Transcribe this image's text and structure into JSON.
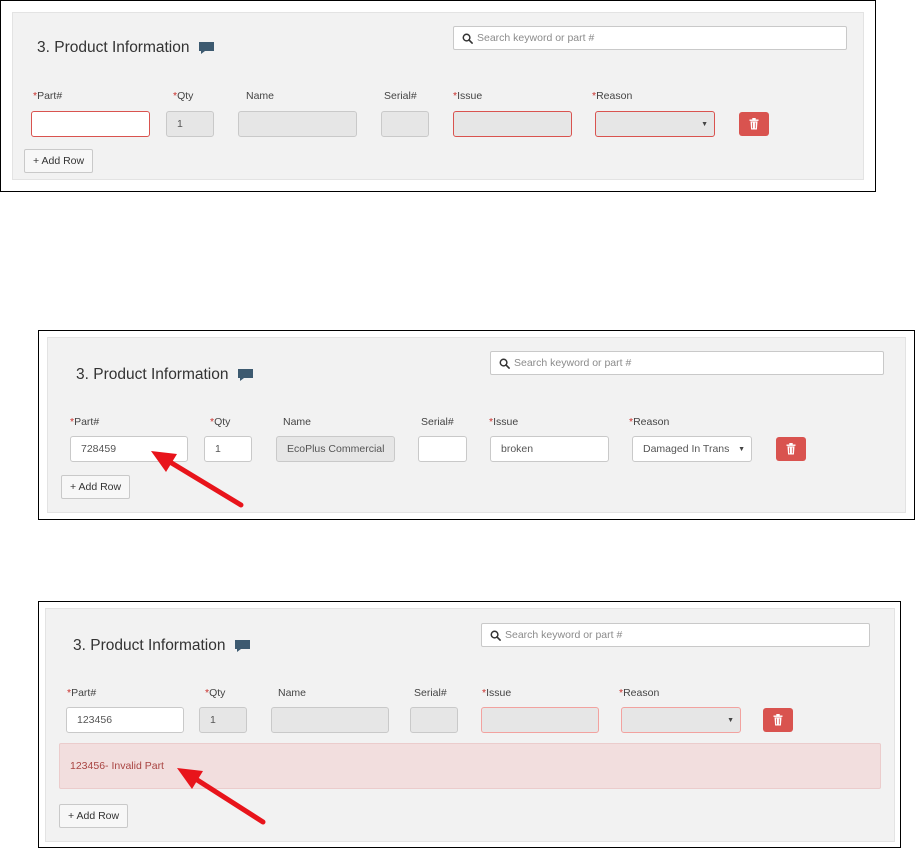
{
  "colors": {
    "required_asterisk": "#c9302c",
    "delete_button": "#d9534f",
    "error_border": "#d9534f",
    "alert_background": "#f2dede",
    "alert_text": "#a94442",
    "annotation_arrow": "#e8141b",
    "chat_icon": "#3d5a70"
  },
  "icons": {
    "comment": "chat-bubble-icon",
    "search": "magnifier-icon",
    "delete": "trash-icon",
    "dropdown": "caret-down-icon",
    "annotation": "red-arrow"
  },
  "panels": [
    {
      "title": "3. Product Information",
      "search_placeholder": "Search keyword or part #",
      "labels": {
        "part": "Part#",
        "qty": "Qty",
        "name": "Name",
        "serial": "Serial#",
        "issue": "Issue",
        "reason": "Reason"
      },
      "required_mark": "*",
      "values": {
        "part": "",
        "qty": "1",
        "name": "",
        "serial": "",
        "issue": "",
        "reason": ""
      },
      "add_row_label": "+ Add Row"
    },
    {
      "title": "3. Product Information",
      "search_placeholder": "Search keyword or part #",
      "labels": {
        "part": "Part#",
        "qty": "Qty",
        "name": "Name",
        "serial": "Serial#",
        "issue": "Issue",
        "reason": "Reason"
      },
      "required_mark": "*",
      "values": {
        "part": "728459",
        "qty": "1",
        "name": "EcoPlus Commercial",
        "serial": "",
        "issue": "broken",
        "reason": "Damaged In Trans"
      },
      "add_row_label": "+ Add Row"
    },
    {
      "title": "3. Product Information",
      "search_placeholder": "Search keyword or part #",
      "labels": {
        "part": "Part#",
        "qty": "Qty",
        "name": "Name",
        "serial": "Serial#",
        "issue": "Issue",
        "reason": "Reason"
      },
      "required_mark": "*",
      "values": {
        "part": "123456",
        "qty": "1",
        "name": "",
        "serial": "",
        "issue": "",
        "reason": ""
      },
      "error_message": "123456- Invalid Part",
      "add_row_label": "+ Add Row"
    }
  ]
}
